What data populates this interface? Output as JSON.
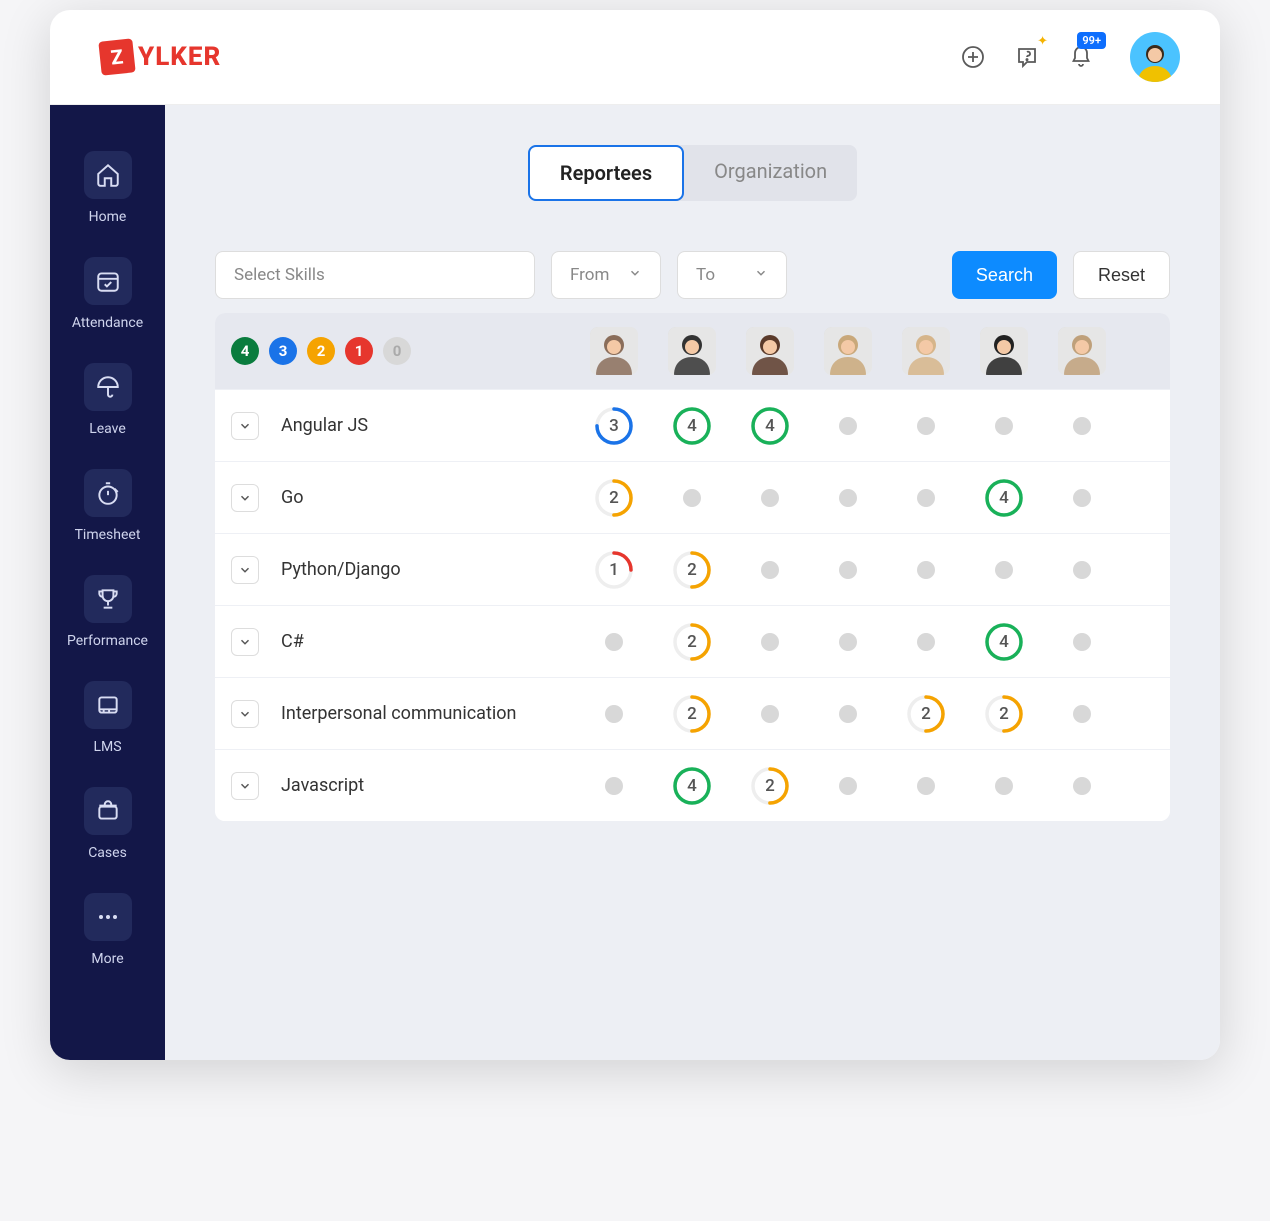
{
  "brand": {
    "badge_letter": "Z",
    "name": "YLKER"
  },
  "header": {
    "notification_badge": "99+"
  },
  "sidebar": {
    "items": [
      {
        "label": "Home",
        "icon": "home-icon"
      },
      {
        "label": "Attendance",
        "icon": "calendar-check-icon"
      },
      {
        "label": "Leave",
        "icon": "umbrella-icon"
      },
      {
        "label": "Timesheet",
        "icon": "stopwatch-icon"
      },
      {
        "label": "Performance",
        "icon": "trophy-icon"
      },
      {
        "label": "LMS",
        "icon": "book-icon"
      },
      {
        "label": "Cases",
        "icon": "briefcase-icon"
      },
      {
        "label": "More",
        "icon": "more-icon"
      }
    ]
  },
  "tabs": {
    "reportees": "Reportees",
    "organization": "Organization",
    "active": "reportees"
  },
  "filters": {
    "skills_placeholder": "Select Skills",
    "from_label": "From",
    "to_label": "To",
    "search_label": "Search",
    "reset_label": "Reset"
  },
  "legend": {
    "l4": "4",
    "l3": "3",
    "l2": "2",
    "l1": "1",
    "l0": "0"
  },
  "employees": [
    {
      "name": "employee-1"
    },
    {
      "name": "employee-2"
    },
    {
      "name": "employee-3"
    },
    {
      "name": "employee-4"
    },
    {
      "name": "employee-5"
    },
    {
      "name": "employee-6"
    },
    {
      "name": "employee-7"
    }
  ],
  "score_colors": {
    "1": "#e6362d",
    "2": "#f5a301",
    "3": "#1a73e8",
    "4": "#19b159"
  },
  "skills": [
    {
      "name": "Angular JS",
      "scores": [
        3,
        4,
        4,
        null,
        null,
        null,
        null
      ]
    },
    {
      "name": "Go",
      "scores": [
        2,
        null,
        null,
        null,
        null,
        4,
        null
      ]
    },
    {
      "name": "Python/Django",
      "scores": [
        1,
        2,
        null,
        null,
        null,
        null,
        null
      ]
    },
    {
      "name": "C#",
      "scores": [
        null,
        2,
        null,
        null,
        null,
        4,
        null
      ]
    },
    {
      "name": "Interpersonal communication",
      "scores": [
        null,
        2,
        null,
        null,
        2,
        2,
        null
      ]
    },
    {
      "name": "Javascript",
      "scores": [
        null,
        4,
        2,
        null,
        null,
        null,
        null
      ]
    }
  ]
}
